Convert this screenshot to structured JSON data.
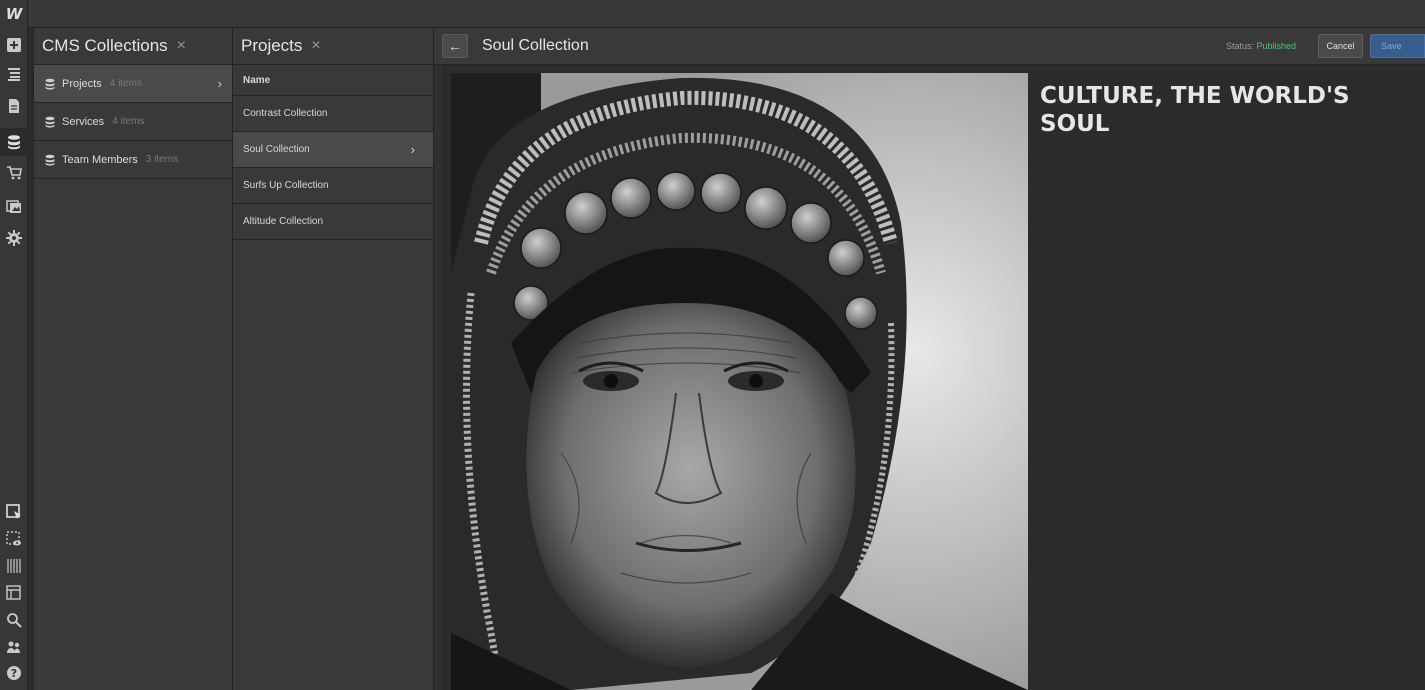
{
  "app": {
    "logo": "W"
  },
  "leftbar": {
    "icons": [
      "add-icon",
      "navigator-icon",
      "pages-icon",
      "cms-icon",
      "ecommerce-icon",
      "assets-icon",
      "settings-icon",
      "select-icon",
      "preview-icon",
      "grid-icon",
      "layout-icon",
      "search-icon",
      "people-icon",
      "help-icon"
    ]
  },
  "collections_panel": {
    "title": "CMS Collections",
    "close": "×",
    "items": [
      {
        "label": "Projects",
        "count": "4 items",
        "selected": true
      },
      {
        "label": "Services",
        "count": "4 items",
        "selected": false
      },
      {
        "label": "Team Members",
        "count": "3 items",
        "selected": false
      }
    ]
  },
  "projects_panel": {
    "title": "Projects",
    "close": "×",
    "column_header": "Name",
    "items": [
      {
        "label": "Contrast Collection",
        "selected": false
      },
      {
        "label": "Soul Collection",
        "selected": true
      },
      {
        "label": "Surfs Up Collection",
        "selected": false
      },
      {
        "label": "Altitude Collection",
        "selected": false
      }
    ]
  },
  "editor": {
    "title": "Soul Collection",
    "back": "←",
    "status_label": "Status:",
    "status_value": "Published",
    "cancel_label": "Cancel",
    "save_label": "Save",
    "heading": "CULTURE, THE WORLD'S SOUL",
    "status_color": "#4fc27a"
  }
}
